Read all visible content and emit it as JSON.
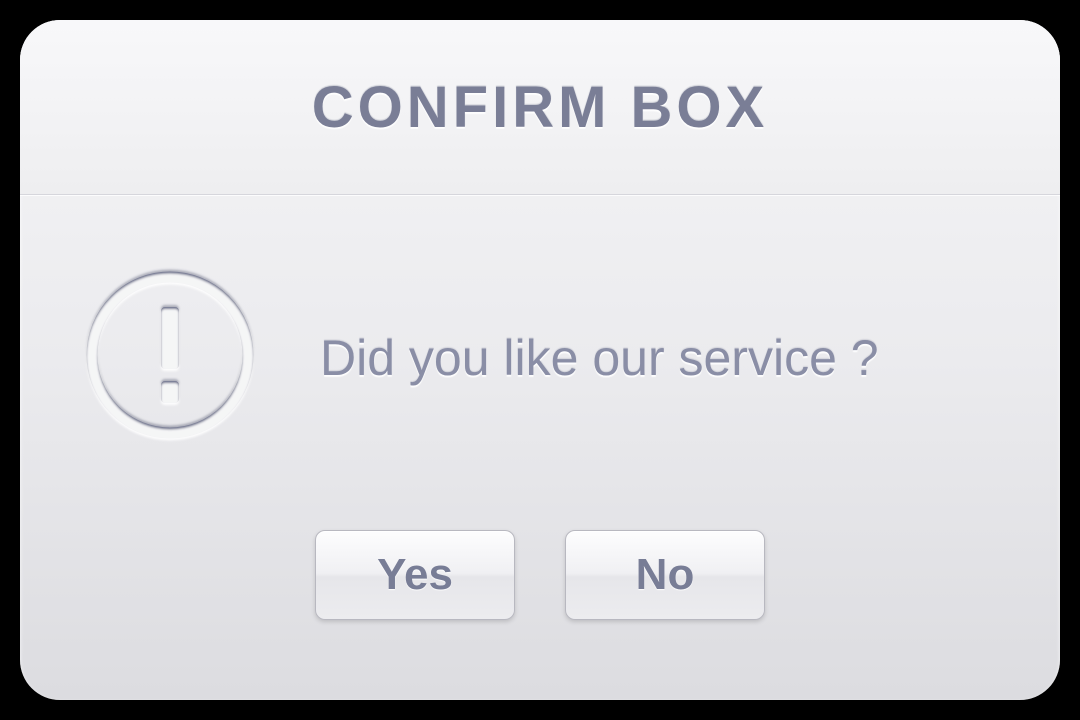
{
  "dialog": {
    "title": "CONFIRM BOX",
    "message": "Did you like our service ?",
    "buttons": {
      "yes": "Yes",
      "no": "No"
    }
  }
}
